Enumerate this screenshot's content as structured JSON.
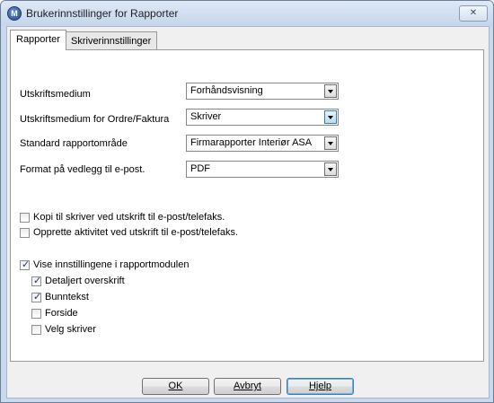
{
  "window": {
    "title": "Brukerinnstillinger for Rapporter",
    "close_symbol": "✕",
    "icon": "app-logo-icon",
    "icon_letter": "M"
  },
  "tabs": [
    {
      "label": "Rapporter",
      "active": true
    },
    {
      "label": "Skriverinnstillinger",
      "active": false
    }
  ],
  "fields": [
    {
      "label": "Utskriftsmedium",
      "value": "Forhåndsvisning"
    },
    {
      "label": "Utskriftsmedium for Ordre/Faktura",
      "value": "Skriver"
    },
    {
      "label": "Standard rapportområde",
      "value": "Firmarapporter Interiør ASA"
    },
    {
      "label": "Format på vedlegg til e-post.",
      "value": "PDF"
    }
  ],
  "checkboxes": {
    "copy_to_printer": {
      "label": "Kopi til skriver ved utskrift til e-post/telefaks.",
      "checked": false
    },
    "create_activity": {
      "label": "Opprette aktivitet ved utskrift til e-post/telefaks.",
      "checked": false
    },
    "show_settings": {
      "label": "Vise innstillingene i rapportmodulen",
      "checked": true
    },
    "detailed_header": {
      "label": "Detaljert overskrift",
      "checked": true
    },
    "footer": {
      "label": "Bunntekst",
      "checked": true
    },
    "cover_page": {
      "label": "Forside",
      "checked": false
    },
    "choose_printer": {
      "label": "Velg skriver",
      "checked": false
    }
  },
  "check_symbol": "✓",
  "buttons": {
    "ok": "OK",
    "cancel": "Avbryt",
    "help": "Hjelp"
  },
  "colors": {
    "title_bar": "#c4d5ec",
    "panel": "#ffffff",
    "check": "#21367a"
  }
}
